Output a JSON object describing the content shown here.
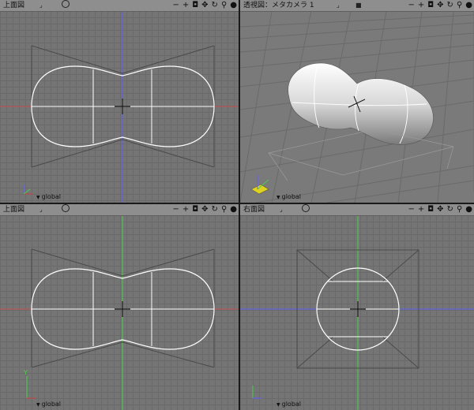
{
  "viewports": {
    "top": {
      "title": "上面図",
      "dropdown_glyph": "⌟",
      "coord_label": "global"
    },
    "perspective": {
      "title": "透視図：メタカメラ 1",
      "dropdown_glyph": "⌟",
      "coord_label": "global"
    },
    "front": {
      "title": "上面図",
      "dropdown_glyph": "⌟",
      "coord_label": "global"
    },
    "side": {
      "title": "右面図",
      "dropdown_glyph": "⌟",
      "coord_label": "global"
    }
  },
  "toolbar_icons": [
    "zoom-out-icon",
    "zoom-in-icon",
    "camera-icon",
    "move-icon",
    "rotate-icon",
    "magnify-icon",
    "render-sphere-icon"
  ],
  "colors": {
    "viewport_bg": "#777777",
    "grid_line": "#6a6a6a",
    "axis_x": "#d04040",
    "axis_y": "#4ad04a",
    "axis_z": "#6060ff",
    "curve": "#ffffff",
    "bounding_box": "#4a4a4a"
  },
  "axes": {
    "top_right_axis": "red",
    "front_vertical_axis": "green",
    "side_horizontal_axis": "blue"
  }
}
